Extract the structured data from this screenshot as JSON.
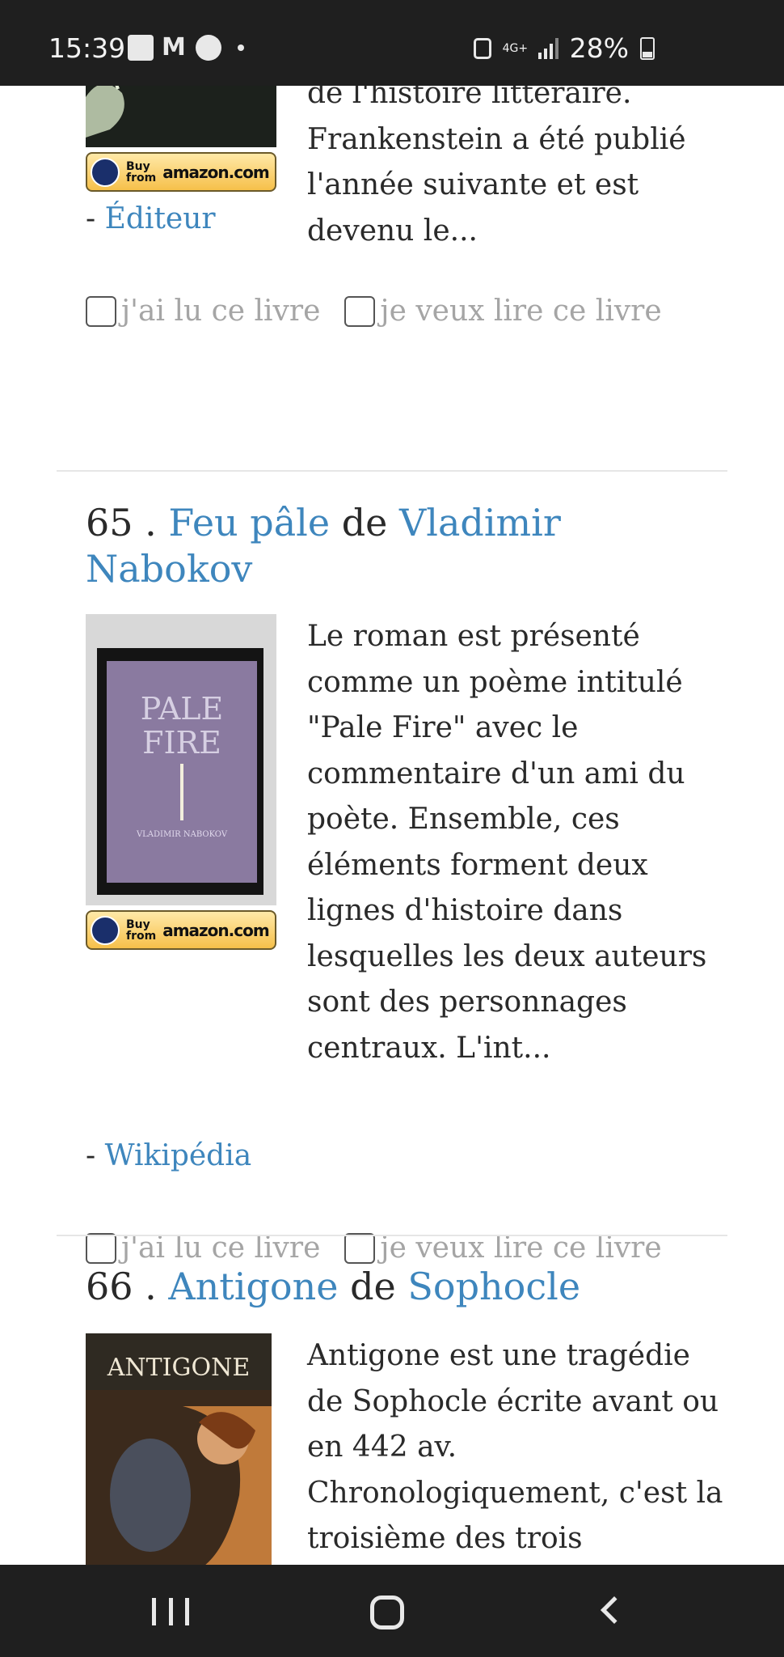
{
  "status_bar": {
    "time": "15:39",
    "network": "4G+",
    "battery": "28%"
  },
  "entries": [
    {
      "description_text": "de l'histoire littéraire. Frankenstein a été publié l'année suivante et est devenu le...",
      "source_prefix": "- ",
      "source_label": "Éditeur",
      "buy_badge": {
        "top": "Buy",
        "bottom": "from",
        "brand": "amazon.com"
      },
      "read_label": "j'ai lu ce livre",
      "want_label": "je veux lire ce livre"
    },
    {
      "number": "65",
      "separator": " . ",
      "title": "Feu pâle",
      "by": " de ",
      "author": "Vladimir Nabokov",
      "cover": {
        "title_line1": "PALE",
        "title_line2": "FIRE",
        "author": "VLADIMIR NABOKOV"
      },
      "buy_badge": {
        "top": "Buy",
        "bottom": "from",
        "brand": "amazon.com"
      },
      "description_text": "Le roman est présenté comme un poème intitulé \"Pale Fire\" avec le commentaire d'un ami du poète. Ensemble, ces éléments forment deux lignes d'histoire dans lesquelles les deux auteurs sont des personnages centraux. L'int...",
      "source_prefix": "- ",
      "source_label": "Wikipédia",
      "read_label": "j'ai lu ce livre",
      "want_label": "je veux lire ce livre"
    },
    {
      "number": "66",
      "separator": " . ",
      "title": "Antigone",
      "by": " de ",
      "author": "Sophocle",
      "cover": {
        "title": "ANTIGONE"
      },
      "description_text": "Antigone est une tragédie de Sophocle écrite avant ou en 442 av. Chronologiquement, c'est la troisième des trois"
    }
  ]
}
